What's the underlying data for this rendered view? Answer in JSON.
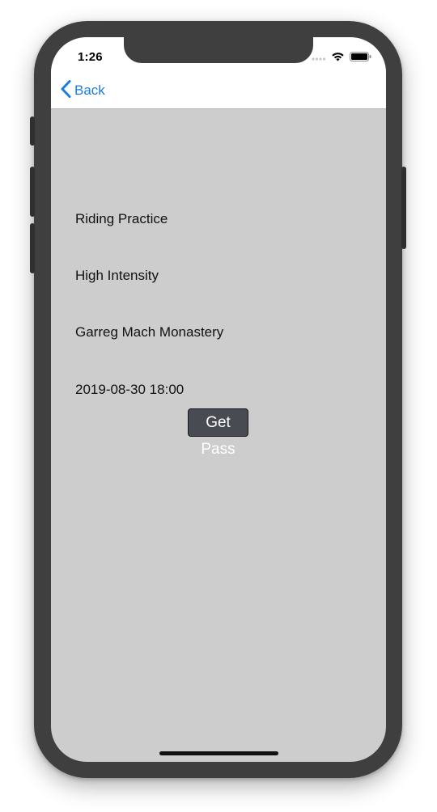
{
  "status_bar": {
    "time": "1:26"
  },
  "nav": {
    "back_label": "Back"
  },
  "details": {
    "activity": "Riding Practice",
    "intensity": "High Intensity",
    "location": "Garreg Mach Monastery",
    "datetime": "2019-08-30 18:00"
  },
  "actions": {
    "get_pass_label": "Get Pass"
  },
  "colors": {
    "accent": "#1a7de0",
    "background": "#cdcdcd",
    "button": "#484b51"
  },
  "icons": [
    "back-chevron-icon",
    "cellular-signal-icon",
    "wifi-icon",
    "battery-icon"
  ]
}
